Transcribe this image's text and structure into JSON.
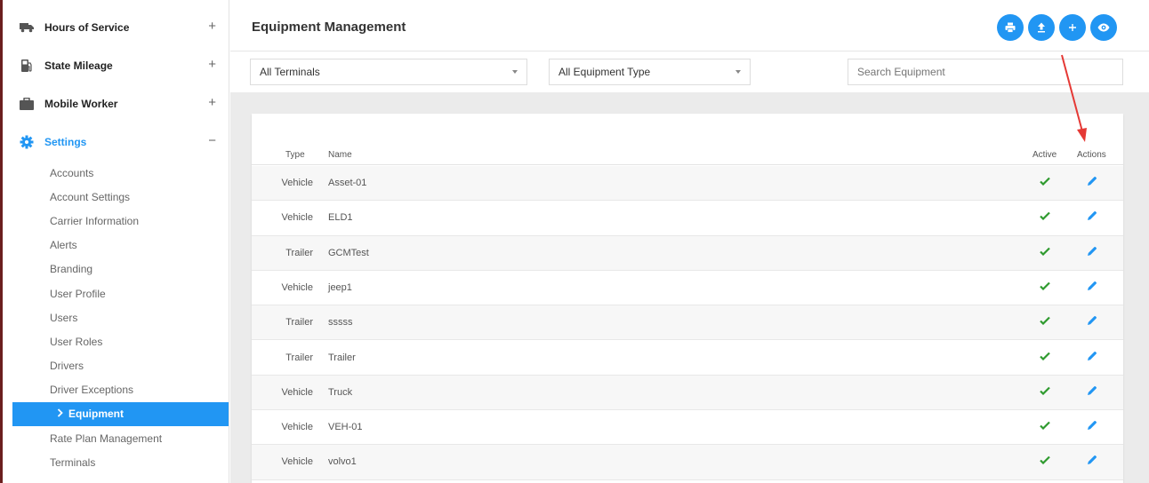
{
  "sidebar": {
    "main_items": [
      {
        "label": "Hours of Service",
        "toggle": "+"
      },
      {
        "label": "State Mileage",
        "toggle": "+"
      },
      {
        "label": "Mobile Worker",
        "toggle": "+"
      },
      {
        "label": "Settings",
        "toggle": "−"
      }
    ],
    "sub_items": [
      {
        "label": "Accounts"
      },
      {
        "label": "Account Settings"
      },
      {
        "label": "Carrier Information"
      },
      {
        "label": "Alerts"
      },
      {
        "label": "Branding"
      },
      {
        "label": "User Profile"
      },
      {
        "label": "Users"
      },
      {
        "label": "User Roles"
      },
      {
        "label": "Drivers"
      },
      {
        "label": "Driver Exceptions"
      },
      {
        "label": "Equipment"
      },
      {
        "label": "Rate Plan Management"
      },
      {
        "label": "Terminals"
      }
    ]
  },
  "header": {
    "title": "Equipment Management",
    "buttons": [
      "print-icon",
      "upload-icon",
      "plus-icon",
      "eye-icon"
    ]
  },
  "filters": {
    "terminal": "All Terminals",
    "equipment_type": "All Equipment Type",
    "search_placeholder": "Search Equipment"
  },
  "table": {
    "columns": {
      "type": "Type",
      "name": "Name",
      "active": "Active",
      "actions": "Actions"
    },
    "rows": [
      {
        "type": "Vehicle",
        "name": "Asset-01"
      },
      {
        "type": "Vehicle",
        "name": "ELD1"
      },
      {
        "type": "Trailer",
        "name": "GCMTest"
      },
      {
        "type": "Vehicle",
        "name": "jeep1"
      },
      {
        "type": "Trailer",
        "name": "sssss"
      },
      {
        "type": "Trailer",
        "name": "Trailer"
      },
      {
        "type": "Vehicle",
        "name": "Truck"
      },
      {
        "type": "Vehicle",
        "name": "VEH-01"
      },
      {
        "type": "Vehicle",
        "name": "volvo1"
      }
    ]
  },
  "colors": {
    "accent": "#2196f3",
    "check": "#2e9a2e",
    "annotation_arrow": "#e53935"
  }
}
